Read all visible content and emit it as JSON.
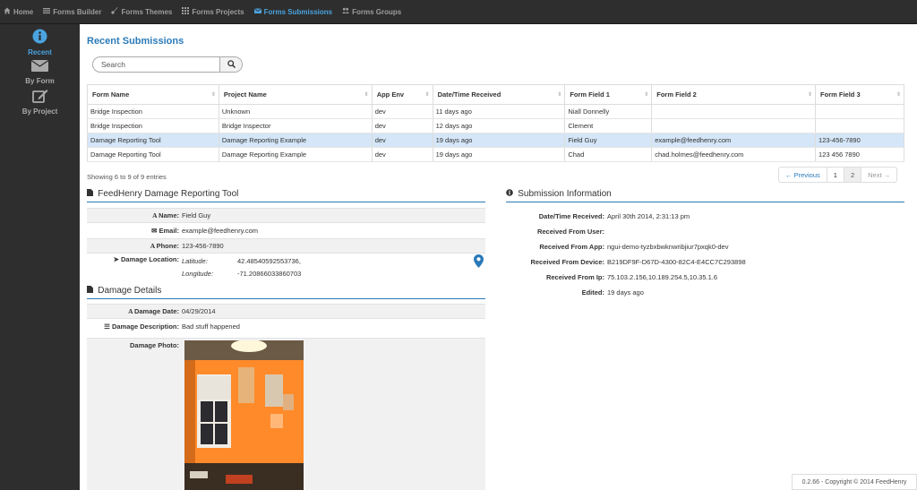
{
  "nav": {
    "items": [
      {
        "label": "Home",
        "icon": "home-icon"
      },
      {
        "label": "Forms Builder",
        "icon": "list-icon"
      },
      {
        "label": "Forms Themes",
        "icon": "brush-icon"
      },
      {
        "label": "Forms Projects",
        "icon": "grid-icon"
      },
      {
        "label": "Forms Submissions",
        "icon": "envelope-icon"
      },
      {
        "label": "Forms Groups",
        "icon": "group-icon"
      }
    ],
    "active_color": "#4aa3df"
  },
  "sidebar": {
    "items": [
      {
        "label": "Recent",
        "icon": "info-circle-icon"
      },
      {
        "label": "By Form",
        "icon": "envelope-icon"
      },
      {
        "label": "By Project",
        "icon": "edit-icon"
      }
    ]
  },
  "main": {
    "title": "Recent Submissions",
    "search_placeholder": "Search",
    "table": {
      "headers": [
        "Form Name",
        "Project Name",
        "App Env",
        "Date/Time Received",
        "Form Field 1",
        "Form Field 2",
        "Form Field 3"
      ],
      "rows": [
        [
          "Bridge Inspection",
          "Unknown",
          "dev",
          "11 days ago",
          "Niall Donnelly",
          "",
          ""
        ],
        [
          "Bridge Inspection",
          "Bridge Inspector",
          "dev",
          "12 days ago",
          "Clement",
          "",
          ""
        ],
        [
          "Damage Reporting Tool",
          "Damage Reporting Example",
          "dev",
          "19 days ago",
          "Field Guy",
          "example@feedhenry.com",
          "123-456-7890"
        ],
        [
          "Damage Reporting Tool",
          "Damage Reporting Example",
          "dev",
          "19 days ago",
          "Chad",
          "chad.holmes@feedhenry.com",
          "123 456 7890"
        ]
      ]
    },
    "showing": "Showing 6 to 9 of 9 entries",
    "pager": {
      "prev": "← Previous",
      "p1": "1",
      "p2": "2",
      "next": "Next →"
    }
  },
  "detail": {
    "title": "FeedHenry Damage Reporting Tool",
    "name_label": "Name:",
    "name": "Field Guy",
    "email_label": "Email:",
    "email": "example@feedhenry.com",
    "phone_label": "Phone:",
    "phone": "123-456-7890",
    "location_label": "Damage Location:",
    "lat_label": "Latitude:",
    "lat": "42.48540592553736,",
    "lng_label": "Longitude:",
    "lng": "-71.20866033860703",
    "damage_section": "Damage Details",
    "date_label": "Damage Date:",
    "date": "04/29/2014",
    "desc_label": "Damage Description:",
    "desc": "Bad stuff happened",
    "photo_label": "Damage Photo:"
  },
  "info": {
    "title": "Submission Information",
    "rows": [
      {
        "label": "Date/Time Received:",
        "value": "April 30th 2014, 2:31:13 pm"
      },
      {
        "label": "Received From User:",
        "value": ""
      },
      {
        "label": "Received From App:",
        "value": "ngui-demo-tyzbxbwknwribjiur7pxqk0-dev"
      },
      {
        "label": "Received From Device:",
        "value": "B219DF9F-D67D-4300-82C4-E4CC7C293898"
      },
      {
        "label": "Received From Ip:",
        "value": "75.103.2.156,10.189.254.5,10.35.1.6"
      },
      {
        "label": "Edited:",
        "value": "19 days ago"
      }
    ]
  },
  "footer": "0.2.66 - Copyright © 2014 FeedHenry"
}
